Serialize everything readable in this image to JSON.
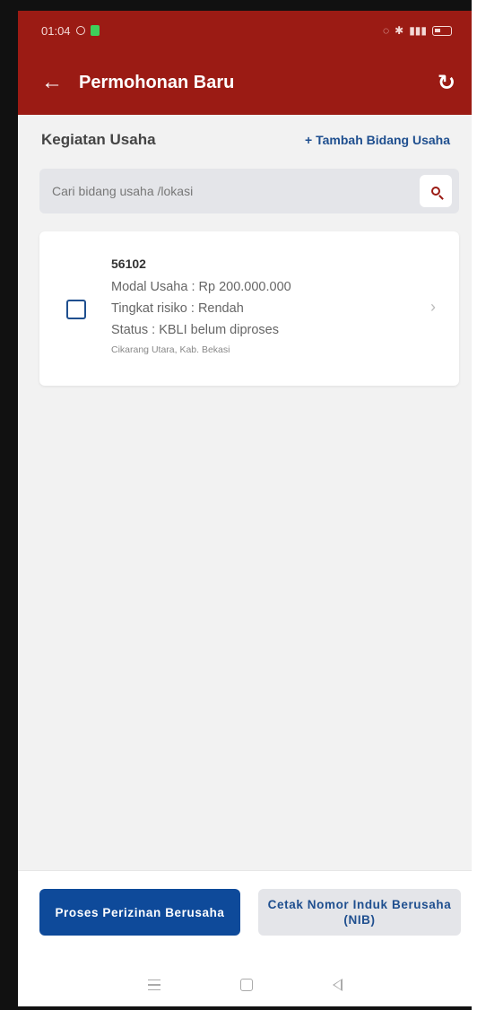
{
  "status_bar": {
    "time": "01:04"
  },
  "app_bar": {
    "title": "Permohonan Baru"
  },
  "section": {
    "title": "Kegiatan Usaha",
    "add_link": "+ Tambah Bidang Usaha"
  },
  "search": {
    "placeholder": "Cari bidang usaha /lokasi",
    "value": ""
  },
  "cards": [
    {
      "code": "56102",
      "modal": "Modal Usaha : Rp 200.000.000",
      "risk": "Tingkat risiko : Rendah",
      "status": "Status : KBLI belum diproses",
      "location": "Cikarang Utara, Kab. Bekasi",
      "checked": false
    }
  ],
  "buttons": {
    "primary": "Proses Perizinan Berusaha",
    "secondary": "Cetak Nomor Induk Berusaha (NIB)"
  },
  "colors": {
    "header": "#9b1b14",
    "primary": "#0e4a9a",
    "link": "#1f4f8f"
  },
  "icons": {
    "back": "arrow-left-icon",
    "refresh": "refresh-icon",
    "search": "search-icon",
    "chevron": "chevron-right-icon",
    "nav": [
      "menu-icon",
      "home-icon",
      "back-triangle-icon"
    ]
  }
}
